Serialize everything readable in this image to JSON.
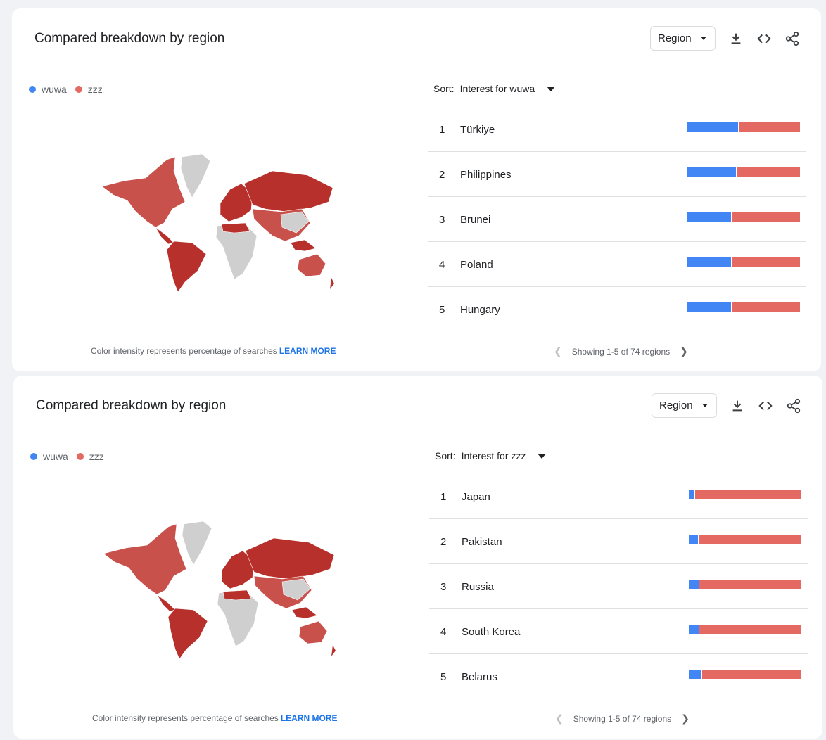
{
  "colors": {
    "wuwa": "#4285f4",
    "zzz": "#e46962",
    "map_dark": "#b7302b",
    "map_mid": "#c9514c",
    "map_none": "#cfcfcf",
    "learn_link": "#1a73e8"
  },
  "cards": [
    {
      "title": "Compared breakdown by region",
      "region_label": "Region",
      "legend": [
        "wuwa",
        "zzz"
      ],
      "sort_label": "Sort:",
      "sort_value": "Interest for wuwa",
      "rows": [
        {
          "rank": "1",
          "name": "Türkiye",
          "wuwa_share": 0.45
        },
        {
          "rank": "2",
          "name": "Philippines",
          "wuwa_share": 0.43
        },
        {
          "rank": "3",
          "name": "Brunei",
          "wuwa_share": 0.39
        },
        {
          "rank": "4",
          "name": "Poland",
          "wuwa_share": 0.39
        },
        {
          "rank": "5",
          "name": "Hungary",
          "wuwa_share": 0.39
        }
      ],
      "footnote": "Color intensity represents percentage of searches",
      "learn_more": "LEARN MORE",
      "pager": "Showing 1-5 of 74 regions"
    },
    {
      "title": "Compared breakdown by region",
      "region_label": "Region",
      "legend": [
        "wuwa",
        "zzz"
      ],
      "sort_label": "Sort:",
      "sort_value": "Interest for zzz",
      "rows": [
        {
          "rank": "1",
          "name": "Japan",
          "wuwa_share": 0.05
        },
        {
          "rank": "2",
          "name": "Pakistan",
          "wuwa_share": 0.08
        },
        {
          "rank": "3",
          "name": "Russia",
          "wuwa_share": 0.09
        },
        {
          "rank": "4",
          "name": "South Korea",
          "wuwa_share": 0.09
        },
        {
          "rank": "5",
          "name": "Belarus",
          "wuwa_share": 0.11
        }
      ],
      "footnote": "Color intensity represents percentage of searches",
      "learn_more": "LEARN MORE",
      "pager": "Showing 1-5 of 74 regions"
    }
  ]
}
